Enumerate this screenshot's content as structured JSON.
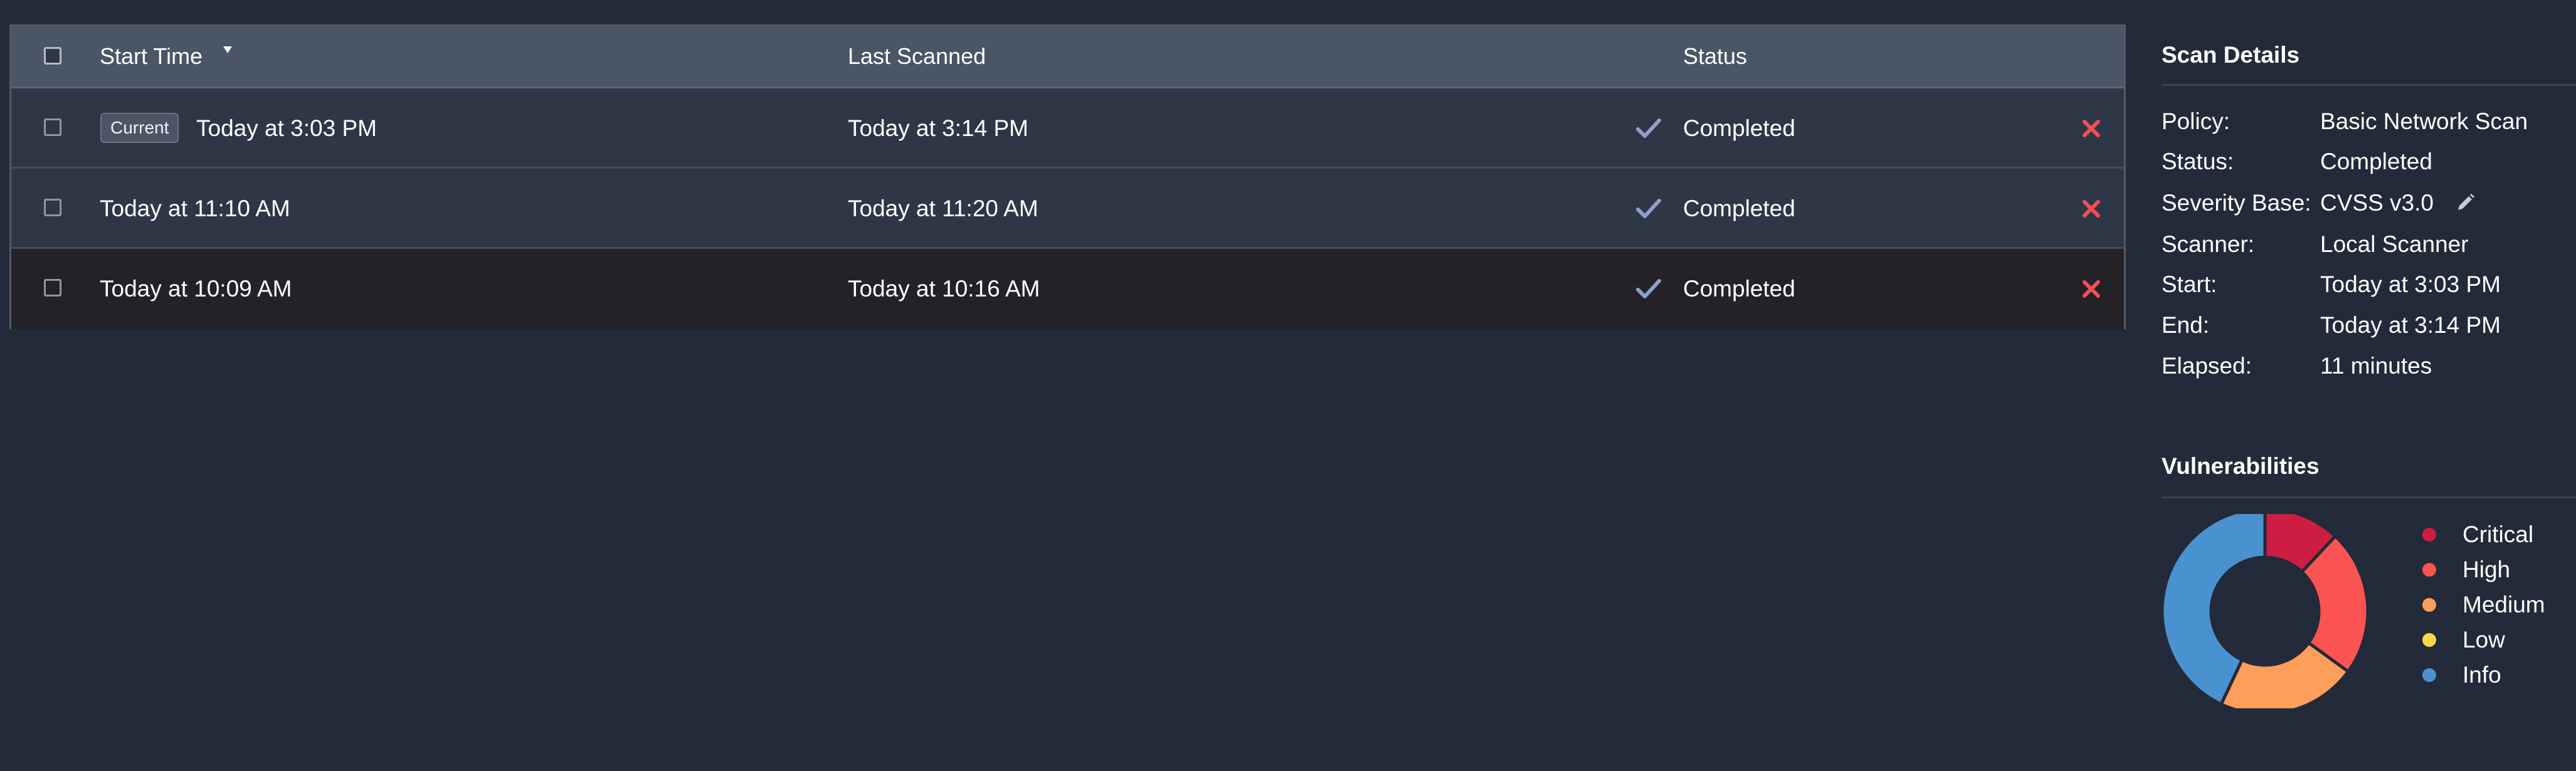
{
  "table": {
    "columns": {
      "start_time": "Start Time",
      "last_scanned": "Last Scanned",
      "status": "Status"
    },
    "rows": [
      {
        "badge": "Current",
        "start": "Today at 3:03 PM",
        "last": "Today at 3:14 PM",
        "status": "Completed"
      },
      {
        "badge": "",
        "start": "Today at 11:10 AM",
        "last": "Today at 11:20 AM",
        "status": "Completed"
      },
      {
        "badge": "",
        "start": "Today at 10:09 AM",
        "last": "Today at 10:16 AM",
        "status": "Completed"
      }
    ],
    "sort_icon": "caret-down-icon",
    "status_icon": "check-icon",
    "delete_icon": "close-icon"
  },
  "scan_details": {
    "title": "Scan Details",
    "items": [
      {
        "label": "Policy:",
        "value": "Basic Network Scan"
      },
      {
        "label": "Status:",
        "value": "Completed"
      },
      {
        "label": "Severity Base:",
        "value": "CVSS v3.0"
      },
      {
        "label": "Scanner:",
        "value": "Local Scanner"
      },
      {
        "label": "Start:",
        "value": "Today at 3:03 PM"
      },
      {
        "label": "End:",
        "value": "Today at 3:14 PM"
      },
      {
        "label": "Elapsed:",
        "value": "11 minutes"
      }
    ],
    "edit_icon": "pencil-icon"
  },
  "vulnerabilities": {
    "title": "Vulnerabilities",
    "legend": [
      {
        "label": "Critical",
        "color": "#cd1d43"
      },
      {
        "label": "High",
        "color": "#fa5352"
      },
      {
        "label": "Medium",
        "color": "#fd9e5a"
      },
      {
        "label": "Low",
        "color": "#ffd64a"
      },
      {
        "label": "Info",
        "color": "#4a92cf"
      }
    ]
  },
  "chart_data": {
    "type": "pie",
    "categories": [
      "Critical",
      "High",
      "Medium",
      "Low",
      "Info"
    ],
    "values": [
      12,
      23,
      22,
      0,
      43
    ],
    "colors": [
      "#cd1d43",
      "#fa5352",
      "#fd9e5a",
      "#ffd64a",
      "#4a92cf"
    ],
    "legend_position": "right"
  },
  "colors": {
    "background": "#232a39",
    "header": "#4a5565",
    "row": "#2f3746",
    "selected_row": "#242127",
    "check": "#8fa0c6",
    "delete": "#f24f57"
  }
}
